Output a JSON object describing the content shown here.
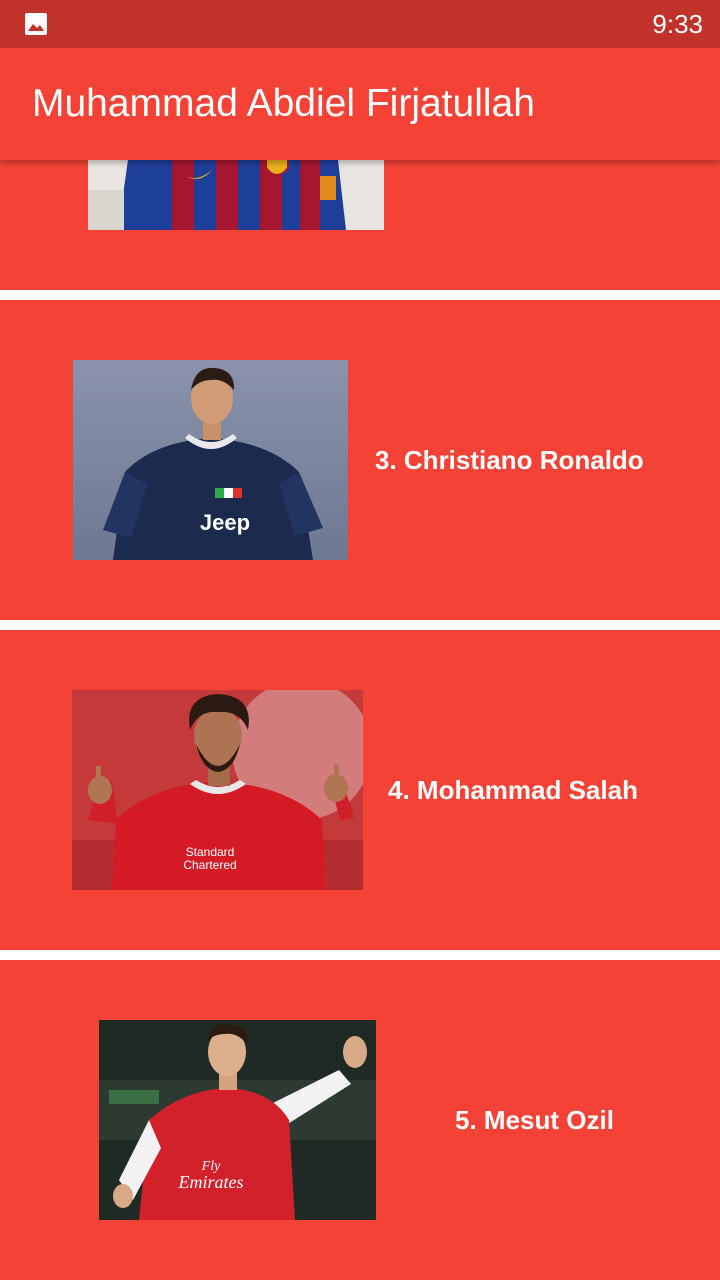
{
  "status_bar": {
    "time": "9:33",
    "icon": "gallery-icon"
  },
  "app_bar": {
    "title": "Muhammad Abdiel Firjatullah"
  },
  "colors": {
    "status_bar": "#c0322a",
    "app_bar": "#f44336",
    "card": "#f44336",
    "divider": "#ffffff",
    "text": "#ffffff"
  },
  "players": [
    {
      "name": "",
      "photo": "lionel-messi-barcelona-photo"
    },
    {
      "name": "3. Christiano Ronaldo",
      "photo": "cristiano-ronaldo-juventus-photo"
    },
    {
      "name": "4. Mohammad Salah",
      "photo": "mohamed-salah-liverpool-photo"
    },
    {
      "name": "5. Mesut Ozil",
      "photo": "mesut-ozil-arsenal-photo"
    }
  ]
}
